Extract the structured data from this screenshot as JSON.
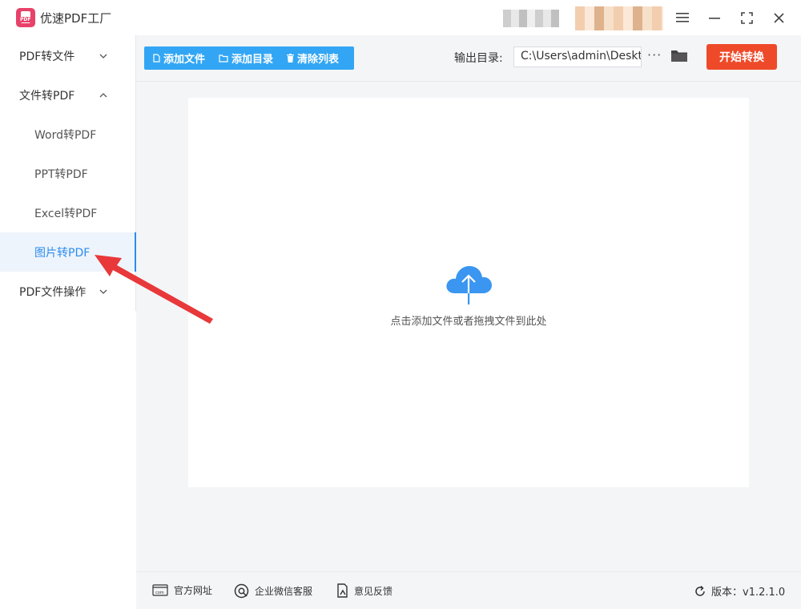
{
  "app": {
    "title": "优速PDF工厂",
    "logo_text": "PDF"
  },
  "window_controls": {
    "menu_icon": "hamburger-icon",
    "minimize_icon": "minimize-icon",
    "maximize_icon": "maximize-icon",
    "close_icon": "close-icon"
  },
  "sidebar": {
    "groups": [
      {
        "label": "PDF转文件",
        "expanded": false
      },
      {
        "label": "文件转PDF",
        "expanded": true,
        "items": [
          {
            "label": "Word转PDF"
          },
          {
            "label": "PPT转PDF"
          },
          {
            "label": "Excel转PDF"
          },
          {
            "label": "图片转PDF",
            "active": true
          }
        ]
      },
      {
        "label": "PDF文件操作",
        "expanded": false
      }
    ]
  },
  "toolbar": {
    "add_file": "添加文件",
    "add_folder": "添加目录",
    "clear_list": "清除列表",
    "output_label": "输出目录:",
    "output_path": "C:\\Users\\admin\\Deskto",
    "more": "···",
    "start": "开始转换"
  },
  "dropzone": {
    "hint": "点击添加文件或者拖拽文件到此处",
    "icon": "cloud-upload-icon"
  },
  "footer": {
    "website": "官方网址",
    "wechat": "企业微信客服",
    "feedback": "意见反馈",
    "version": "版本：v1.2.1.0"
  },
  "colors": {
    "accent_blue": "#32a6f4",
    "active_blue": "#2b8df0",
    "start_red": "#ee4a2a",
    "logo_pink": "#e8416a",
    "annotation_red": "#e8383a"
  }
}
